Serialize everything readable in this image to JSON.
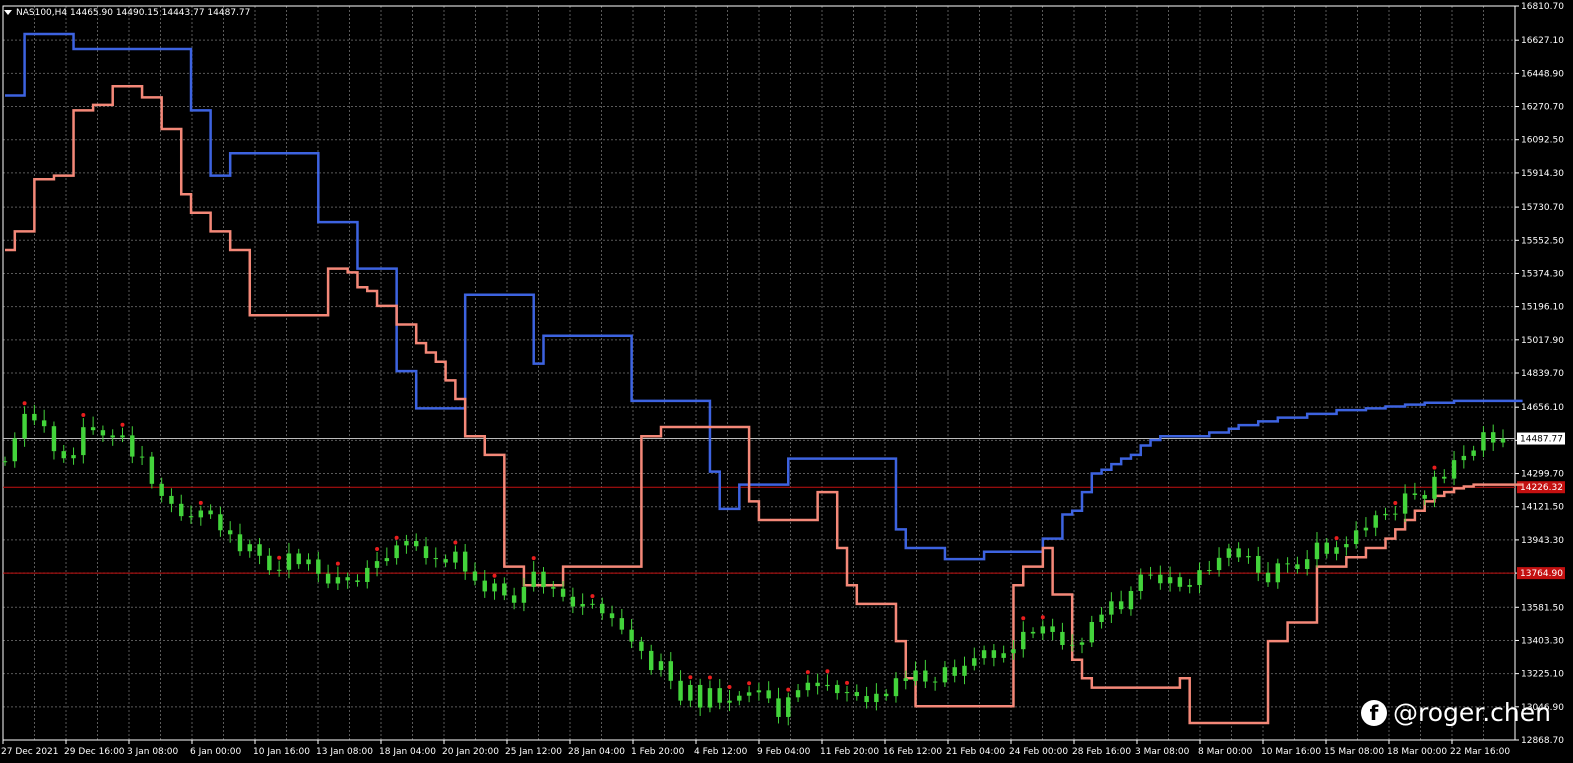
{
  "header": {
    "symbol": "NAS100,H4",
    "ohlc": "14465.90 14490.15 14443.77 14487.77"
  },
  "watermark": {
    "text": "@roger.chen",
    "icon": "facebook-icon"
  },
  "colors": {
    "background": "#000000",
    "grid": "#5a5a5a",
    "candle": "#43d43b",
    "upper_band": "#3d63e0",
    "lower_band": "#f48878",
    "dot": "#e81e1e",
    "hline": "#c41010",
    "price_tag_bg": "#ffffff"
  },
  "chart_data": {
    "type": "line",
    "title": "",
    "ylim": [
      12868.7,
      16810.7
    ],
    "y_ticks": [
      "16810.70",
      "16627.10",
      "16448.90",
      "16270.70",
      "16092.50",
      "15914.30",
      "15730.70",
      "15552.50",
      "15374.30",
      "15196.10",
      "15017.90",
      "14839.70",
      "14656.10",
      "14477.90",
      "14299.70",
      "14121.50",
      "13943.30",
      "13765.10",
      "13581.50",
      "13403.30",
      "13225.10",
      "13046.90",
      "12868.70"
    ],
    "x_ticks": [
      "27 Dec 2021",
      "29 Dec 16:00",
      "3 Jan 08:00",
      "6 Jan 00:00",
      "10 Jan 16:00",
      "13 Jan 08:00",
      "18 Jan 04:00",
      "20 Jan 20:00",
      "25 Jan 12:00",
      "28 Jan 04:00",
      "1 Feb 20:00",
      "4 Feb 12:00",
      "9 Feb 04:00",
      "11 Feb 20:00",
      "16 Feb 12:00",
      "21 Feb 04:00",
      "24 Feb 00:00",
      "28 Feb 16:00",
      "3 Mar 08:00",
      "8 Mar 00:00",
      "10 Mar 16:00",
      "15 Mar 08:00",
      "18 Mar 00:00",
      "22 Mar 16:00"
    ],
    "current_price": {
      "value": 14487.77,
      "label": "14487.77"
    },
    "levels": [
      {
        "value": 14226.32,
        "label": "14226.32"
      },
      {
        "value": 13764.9,
        "label": "13764.90"
      }
    ],
    "series": [
      {
        "role": "close",
        "values": [
          14365.9,
          14488.2,
          14619.9,
          14585.3,
          14554.1,
          14420.1,
          14382.0,
          14398.8,
          14548.7,
          14532.6,
          14504.5,
          14493.6,
          14504.8,
          14390.8,
          14390.6,
          14244.6,
          14179.6,
          14137.1,
          14071.0,
          14064.4,
          14101.3,
          14081.0,
          13995.0,
          13973.4,
          13882.5,
          13920.1,
          13858.2,
          13780.6,
          13782.7,
          13870.4,
          13813.1,
          13838.2,
          13761.4,
          13709.3,
          13743.0,
          13725.9,
          13717.3,
          13793.1,
          13829.4,
          13845.6,
          13913.9,
          13937.3,
          13909.3,
          13846.0,
          13840.2,
          13821.7,
          13880.2,
          13773.5,
          13724.6,
          13666.8,
          13709.4,
          13645.2,
          13605.8,
          13690.7,
          13772.6,
          13689.8,
          13681.4,
          13637.8,
          13585.5,
          13599.2,
          13600.1,
          13549.0,
          13523.3,
          13461.4,
          13397.5,
          13347.2,
          13244.4,
          13292.0,
          13186.7,
          13080.1,
          13164.3,
          13042.8,
          13147.2,
          13069.0,
          13080.1,
          13106.6,
          13124.7,
          13135.4,
          13092.1,
          12992.4,
          13097.9,
          13136.3,
          13176.3,
          13158.2,
          13164.6,
          13120.6,
          13126.2,
          13104.8,
          13072.6,
          13117.0,
          13104.3,
          13200.5,
          13185.8,
          13241.7,
          13182.7,
          13178.3,
          13259.7,
          13213.4,
          13267.4,
          13308.1,
          13350.9,
          13309.7,
          13334.6,
          13356.3,
          13449.3,
          13440.7,
          13478.9,
          13449.0,
          13379.0,
          13380.1,
          13393.0,
          13502.4,
          13542.0,
          13613.4,
          13571.1,
          13668.9,
          13757.1,
          13756.5,
          13710.6,
          13743.0,
          13691.4,
          13700.9,
          13780.9,
          13781.3,
          13847.1,
          13897.7,
          13849.7,
          13856.9,
          13767.1,
          13715.8,
          13817.4,
          13812.0,
          13787.1,
          13839.9,
          13928.6,
          13868.7,
          13903.8,
          13921.1,
          13994.4,
          14008.9,
          14075.7,
          14082.9,
          14084.3,
          14192.8,
          14184.5,
          14164.4,
          14282.3,
          14272.5,
          14371.8,
          14394.4,
          14423.6,
          14521.8,
          14466.2,
          14487.8
        ]
      },
      {
        "role": "upper_band",
        "values": [
          16330,
          16330,
          16660,
          16660,
          16660,
          16660,
          16660,
          16580,
          16580,
          16580,
          16580,
          16580,
          16580,
          16580,
          16580,
          16580,
          16580,
          16580,
          16580,
          16250,
          16250,
          15900,
          15900,
          16020,
          16020,
          16020,
          16020,
          16020,
          16020,
          16020,
          16020,
          16020,
          15650,
          15650,
          15650,
          15650,
          15400,
          15400,
          15400,
          15400,
          14850,
          14850,
          14650,
          14650,
          14650,
          14650,
          14650,
          15260,
          15260,
          15260,
          15260,
          15260,
          15260,
          15260,
          14890,
          15040,
          15040,
          15040,
          15040,
          15040,
          15040,
          15040,
          15040,
          15040,
          14690,
          14690,
          14690,
          14690,
          14690,
          14690,
          14690,
          14690,
          14310,
          14110,
          14110,
          14240,
          14240,
          14240,
          14240,
          14240,
          14380,
          14380,
          14380,
          14380,
          14380,
          14380,
          14380,
          14380,
          14380,
          14380,
          14380,
          14000,
          13900,
          13900,
          13900,
          13900,
          13840,
          13840,
          13840,
          13840,
          13880,
          13880,
          13880,
          13880,
          13880,
          13880,
          13950,
          13950,
          14080,
          14100,
          14200,
          14300,
          14320,
          14350,
          14380,
          14400,
          14450,
          14480,
          14500,
          14500,
          14500,
          14500,
          14500,
          14520,
          14520,
          14540,
          14560,
          14560,
          14580,
          14580,
          14600,
          14600,
          14600,
          14620,
          14620,
          14620,
          14640,
          14640,
          14640,
          14650,
          14650,
          14660,
          14660,
          14670,
          14670,
          14680,
          14680,
          14680,
          14690,
          14690,
          14690,
          14690,
          14690,
          14690,
          14690,
          14690
        ]
      },
      {
        "role": "lower_band",
        "values": [
          15500,
          15600,
          15600,
          15880,
          15880,
          15900,
          15900,
          16250,
          16250,
          16280,
          16280,
          16380,
          16380,
          16380,
          16320,
          16320,
          16150,
          16150,
          15800,
          15700,
          15700,
          15600,
          15600,
          15500,
          15500,
          15150,
          15150,
          15150,
          15150,
          15150,
          15150,
          15150,
          15150,
          15400,
          15400,
          15380,
          15300,
          15280,
          15200,
          15200,
          15100,
          15100,
          15000,
          14950,
          14900,
          14800,
          14700,
          14500,
          14500,
          14400,
          14400,
          13800,
          13800,
          13700,
          13700,
          13700,
          13700,
          13800,
          13800,
          13800,
          13800,
          13800,
          13800,
          13800,
          13800,
          14500,
          14500,
          14550,
          14550,
          14550,
          14550,
          14550,
          14550,
          14550,
          14550,
          14550,
          14150,
          14050,
          14050,
          14050,
          14050,
          14050,
          14050,
          14200,
          14200,
          13900,
          13700,
          13600,
          13600,
          13600,
          13600,
          13400,
          13200,
          13050,
          13050,
          13050,
          13050,
          13050,
          13050,
          13050,
          13050,
          13050,
          13050,
          13700,
          13800,
          13800,
          13900,
          13650,
          13650,
          13300,
          13200,
          13150,
          13150,
          13150,
          13150,
          13150,
          13150,
          13150,
          13150,
          13150,
          13200,
          12960,
          12960,
          12960,
          12960,
          12960,
          12960,
          12960,
          12960,
          13400,
          13400,
          13500,
          13500,
          13500,
          13800,
          13800,
          13800,
          13850,
          13850,
          13900,
          13900,
          13950,
          14000,
          14050,
          14100,
          14150,
          14180,
          14200,
          14220,
          14230,
          14240,
          14240,
          14240,
          14240,
          14240,
          14240
        ]
      }
    ]
  }
}
